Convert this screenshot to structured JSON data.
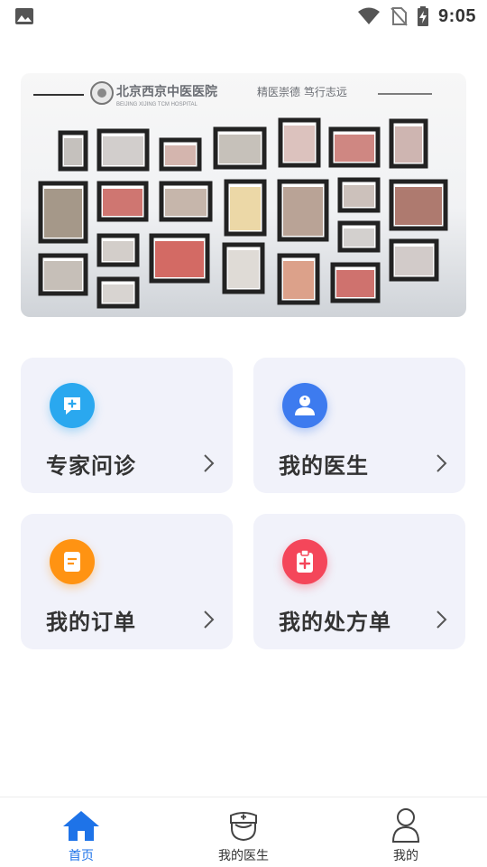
{
  "status_bar": {
    "time": "9:05",
    "icons": [
      "image-icon",
      "wifi-icon",
      "no-sim-icon",
      "battery-charging-icon"
    ]
  },
  "banner": {
    "hospital_name_cn": "北京西京中医医院",
    "hospital_name_en": "BEIJING XIJING TCM HOSPITAL",
    "slogan": "精医崇德 笃行志远",
    "photo": "photo-wall-of-framed-pictures"
  },
  "cards": [
    {
      "id": "expert",
      "label": "专家问诊",
      "icon": "chat-plus-icon",
      "color": "#2aa8ef"
    },
    {
      "id": "doctor",
      "label": "我的医生",
      "icon": "doctor-icon",
      "color": "#3d7bef"
    },
    {
      "id": "order",
      "label": "我的订单",
      "icon": "order-list-icon",
      "color": "#ff9312"
    },
    {
      "id": "rx",
      "label": "我的处方单",
      "icon": "prescription-icon",
      "color": "#f4465a"
    }
  ],
  "bottom_nav": {
    "items": [
      {
        "label": "首页",
        "icon": "home-icon",
        "active": true
      },
      {
        "label": "我的医生",
        "icon": "doctor-cap-icon",
        "active": false
      },
      {
        "label": "我的",
        "icon": "person-icon",
        "active": false
      }
    ],
    "active_color": "#1e73e8"
  }
}
